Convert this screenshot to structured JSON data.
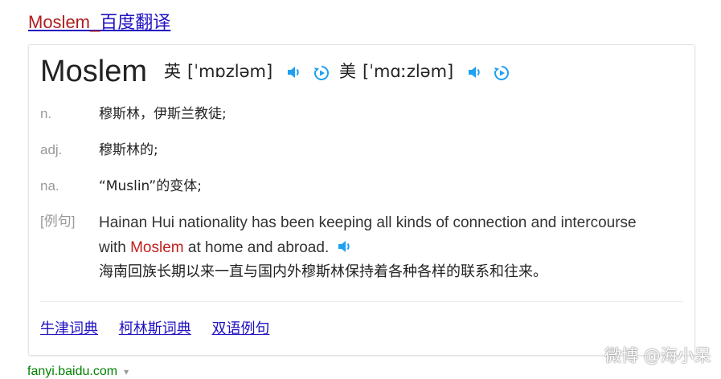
{
  "title": {
    "en": "Moslem",
    "sep": "_",
    "zh": "百度翻译"
  },
  "entry": {
    "word": "Moslem",
    "uk": {
      "lang": "英",
      "phonetic": "[ˈmɒzləm]"
    },
    "us": {
      "lang": "美",
      "phonetic": "[ˈmɑːzləm]"
    }
  },
  "definitions": [
    {
      "pos": "n.",
      "text": "穆斯林，伊斯兰教徒;"
    },
    {
      "pos": "adj.",
      "text": "穆斯林的;"
    },
    {
      "pos": "na.",
      "text": "“Muslin”的变体;"
    }
  ],
  "example": {
    "tag": "[例句]",
    "en_line1": "Hainan Hui nationality has been keeping all kinds of connection and intercourse",
    "en_line2_pre": "with ",
    "en_highlight": "Moslem",
    "en_line2_post": " at home and abroad.",
    "zh": "海南回族长期以来一直与国内外穆斯林保持着各种各样的联系和往来。"
  },
  "links": [
    "牛津词典",
    "柯林斯词典",
    "双语例句"
  ],
  "domain": "fanyi.baidu.com",
  "domain_arrow": "▾",
  "watermark": "微博 @海小呆",
  "colors": {
    "link": "#2011c2",
    "highlight": "#c41e1e",
    "icon": "#1ea1f2",
    "domain": "#008000"
  },
  "icons": [
    "speaker-icon",
    "replay-icon"
  ]
}
